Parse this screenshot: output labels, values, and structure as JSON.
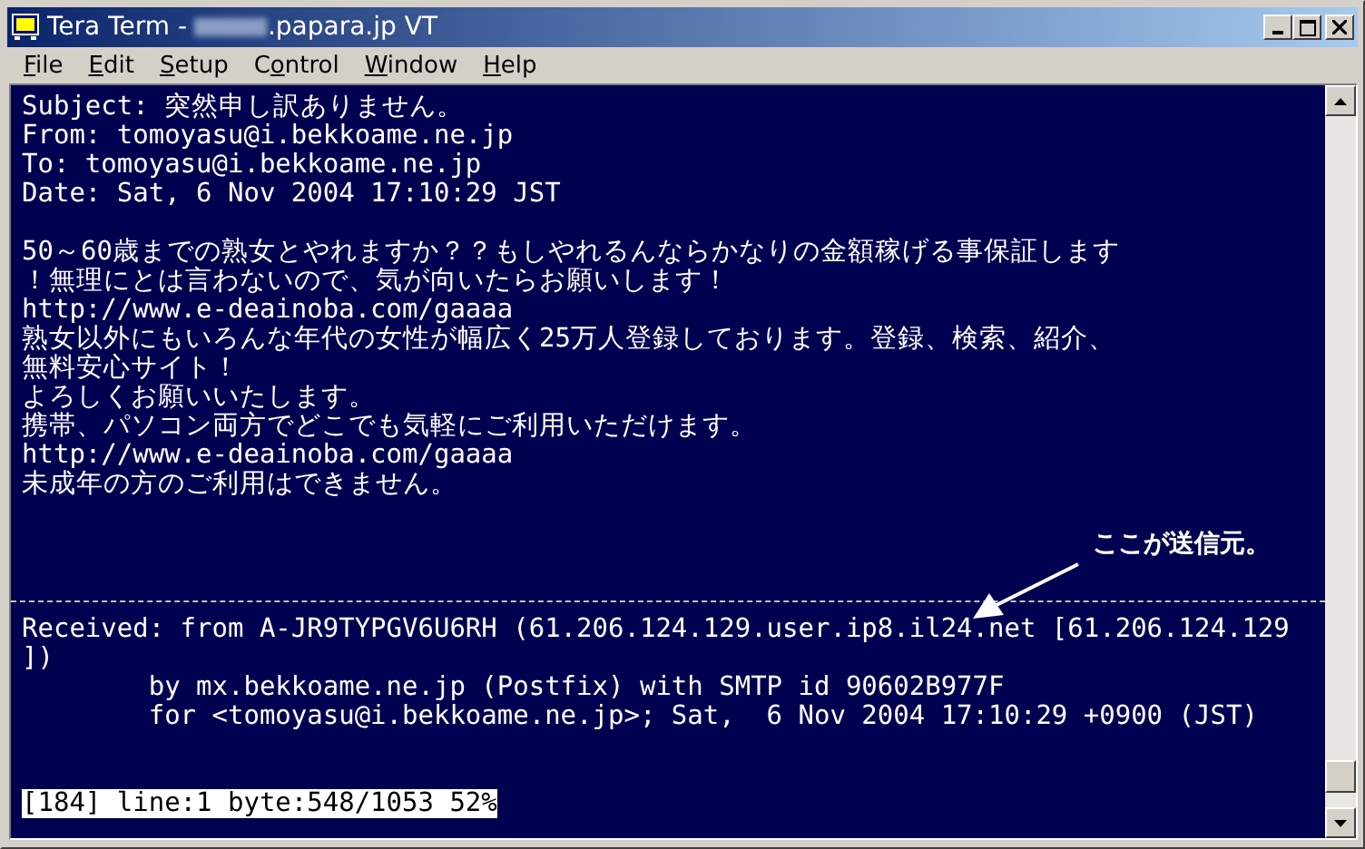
{
  "window": {
    "title_prefix": "Tera Term - ",
    "title_suffix": ".papara.jp VT"
  },
  "menu": [
    {
      "key": "F",
      "after": "ile"
    },
    {
      "key": "E",
      "after": "dit"
    },
    {
      "key": "S",
      "after": "etup"
    },
    {
      "before": "C",
      "key": "o",
      "after": "ntrol"
    },
    {
      "key": "W",
      "after": "indow"
    },
    {
      "key": "H",
      "after": "elp"
    }
  ],
  "terminal": {
    "lines": [
      {
        "kind": "text",
        "text": "Subject: 突然申し訳ありません。"
      },
      {
        "kind": "text",
        "text": "From: tomoyasu@i.bekkoame.ne.jp"
      },
      {
        "kind": "text",
        "text": "To: tomoyasu@i.bekkoame.ne.jp"
      },
      {
        "kind": "text",
        "text": "Date: Sat, 6 Nov 2004 17:10:29 JST"
      },
      {
        "kind": "blank"
      },
      {
        "kind": "text",
        "text": "50～60歳までの熟女とやれますか？？もしやれるんならかなりの金額稼げる事保証します"
      },
      {
        "kind": "text",
        "text": "！無理にとは言わないので、気が向いたらお願いします！"
      },
      {
        "kind": "text",
        "text": "http://www.e-deainoba.com/gaaaa"
      },
      {
        "kind": "text",
        "text": "熟女以外にもいろんな年代の女性が幅広く25万人登録しております。登録、検索、紹介、"
      },
      {
        "kind": "text",
        "text": "無料安心サイト！"
      },
      {
        "kind": "text",
        "text": "よろしくお願いいたします。"
      },
      {
        "kind": "text",
        "text": "携帯、パソコン両方でどこでも気軽にご利用いただけます。"
      },
      {
        "kind": "text",
        "text": "http://www.e-deainoba.com/gaaaa"
      },
      {
        "kind": "text",
        "text": "未成年の方のご利用はできません。"
      },
      {
        "kind": "blank"
      },
      {
        "kind": "blank"
      },
      {
        "kind": "blank"
      },
      {
        "kind": "rule"
      },
      {
        "kind": "text",
        "text": "Received: from A-JR9TYPGV6U6RH (61.206.124.129.user.ip8.il24.net [61.206.124.129"
      },
      {
        "kind": "text",
        "text": "])"
      },
      {
        "kind": "text",
        "text": "        by mx.bekkoame.ne.jp (Postfix) with SMTP id 90602B977F"
      },
      {
        "kind": "text",
        "text": "        for <tomoyasu@i.bekkoame.ne.jp>; Sat,  6 Nov 2004 17:10:29 +0900 (JST)"
      },
      {
        "kind": "blank"
      },
      {
        "kind": "blank"
      },
      {
        "kind": "status",
        "text": "[184] line:1 byte:548/1053 52%"
      }
    ],
    "annotation": "ここが送信元。"
  }
}
